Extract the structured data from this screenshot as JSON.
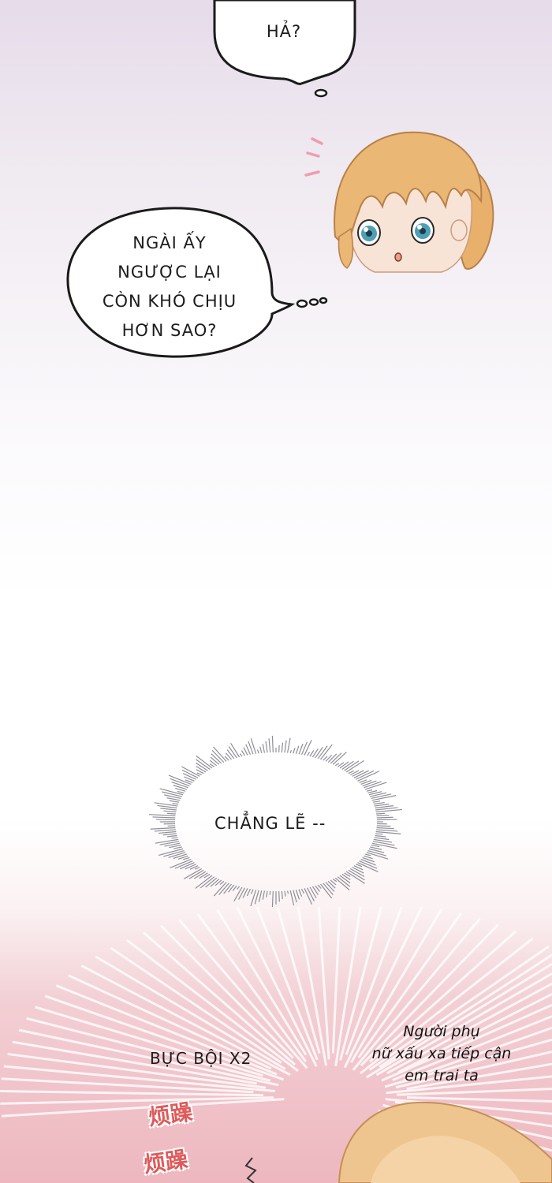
{
  "panel_1": {
    "bubble_top": "HẢ?",
    "bubble_mid_lines": [
      "NGÀI ẤY",
      "NGƯỢC LẠI",
      "CÒN KHÓ CHỊU",
      "HƠN SAO?"
    ]
  },
  "panel_2": {
    "burst_text": "CHẲNG LẼ --"
  },
  "panel_3": {
    "caption_left": "BỰC BỘI X2",
    "handwritten_lines": [
      "Người phụ",
      "nữ xấu xa tiếp cận",
      "em trai ta"
    ],
    "sfx": [
      "烦躁",
      "烦躁"
    ]
  },
  "colors": {
    "skin": "#f6e2d2",
    "hair": "#eab774",
    "eye": "#4f9fb5",
    "sfx_red": "#e05a5a",
    "blush": "#ef9db0"
  }
}
